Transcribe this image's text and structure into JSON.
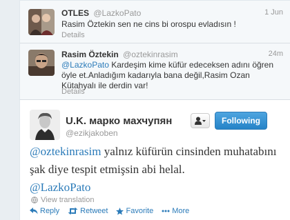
{
  "replies": [
    {
      "fullname": "OTLES",
      "username": "@LazkoPato",
      "time": "1 Jun",
      "text": "Rasim Öztekin sen ne cins bi orospu evladısın !",
      "details": "Details"
    },
    {
      "fullname": "Rasim Öztekin",
      "username": "@oztekinrasim",
      "time": "24m",
      "mention": "@LazkoPato",
      "text": " Kardeşim kime küfür edeceksen adını öğren öyle et.Anladığım kadarıyla bana değil,Rasim Ozan Kütahyalı ile derdin var!",
      "details": "Details"
    }
  ],
  "main_tweet": {
    "fullname": "U.K. марко махчупян",
    "username": "@ezikjakoben",
    "follow_label": "Following",
    "mention1": "@oztekinrasim",
    "text": " yalnız küfürün cinsinden muhatabını şak diye tespit etmişsin abi helal.",
    "mention2": "@LazkoPato",
    "view_translation": "View translation",
    "actions": {
      "reply": "Reply",
      "retweet": "Retweet",
      "favorite": "Favorite",
      "more": "More"
    }
  },
  "icons": {
    "user_dropdown": "user-icon",
    "globe": "globe-icon",
    "reply": "reply-icon",
    "retweet": "retweet-icon",
    "favorite": "star-icon",
    "more": "more-icon"
  },
  "colors": {
    "link": "#2b7bb9",
    "follow_button": "#2583c7",
    "muted": "#999999"
  }
}
